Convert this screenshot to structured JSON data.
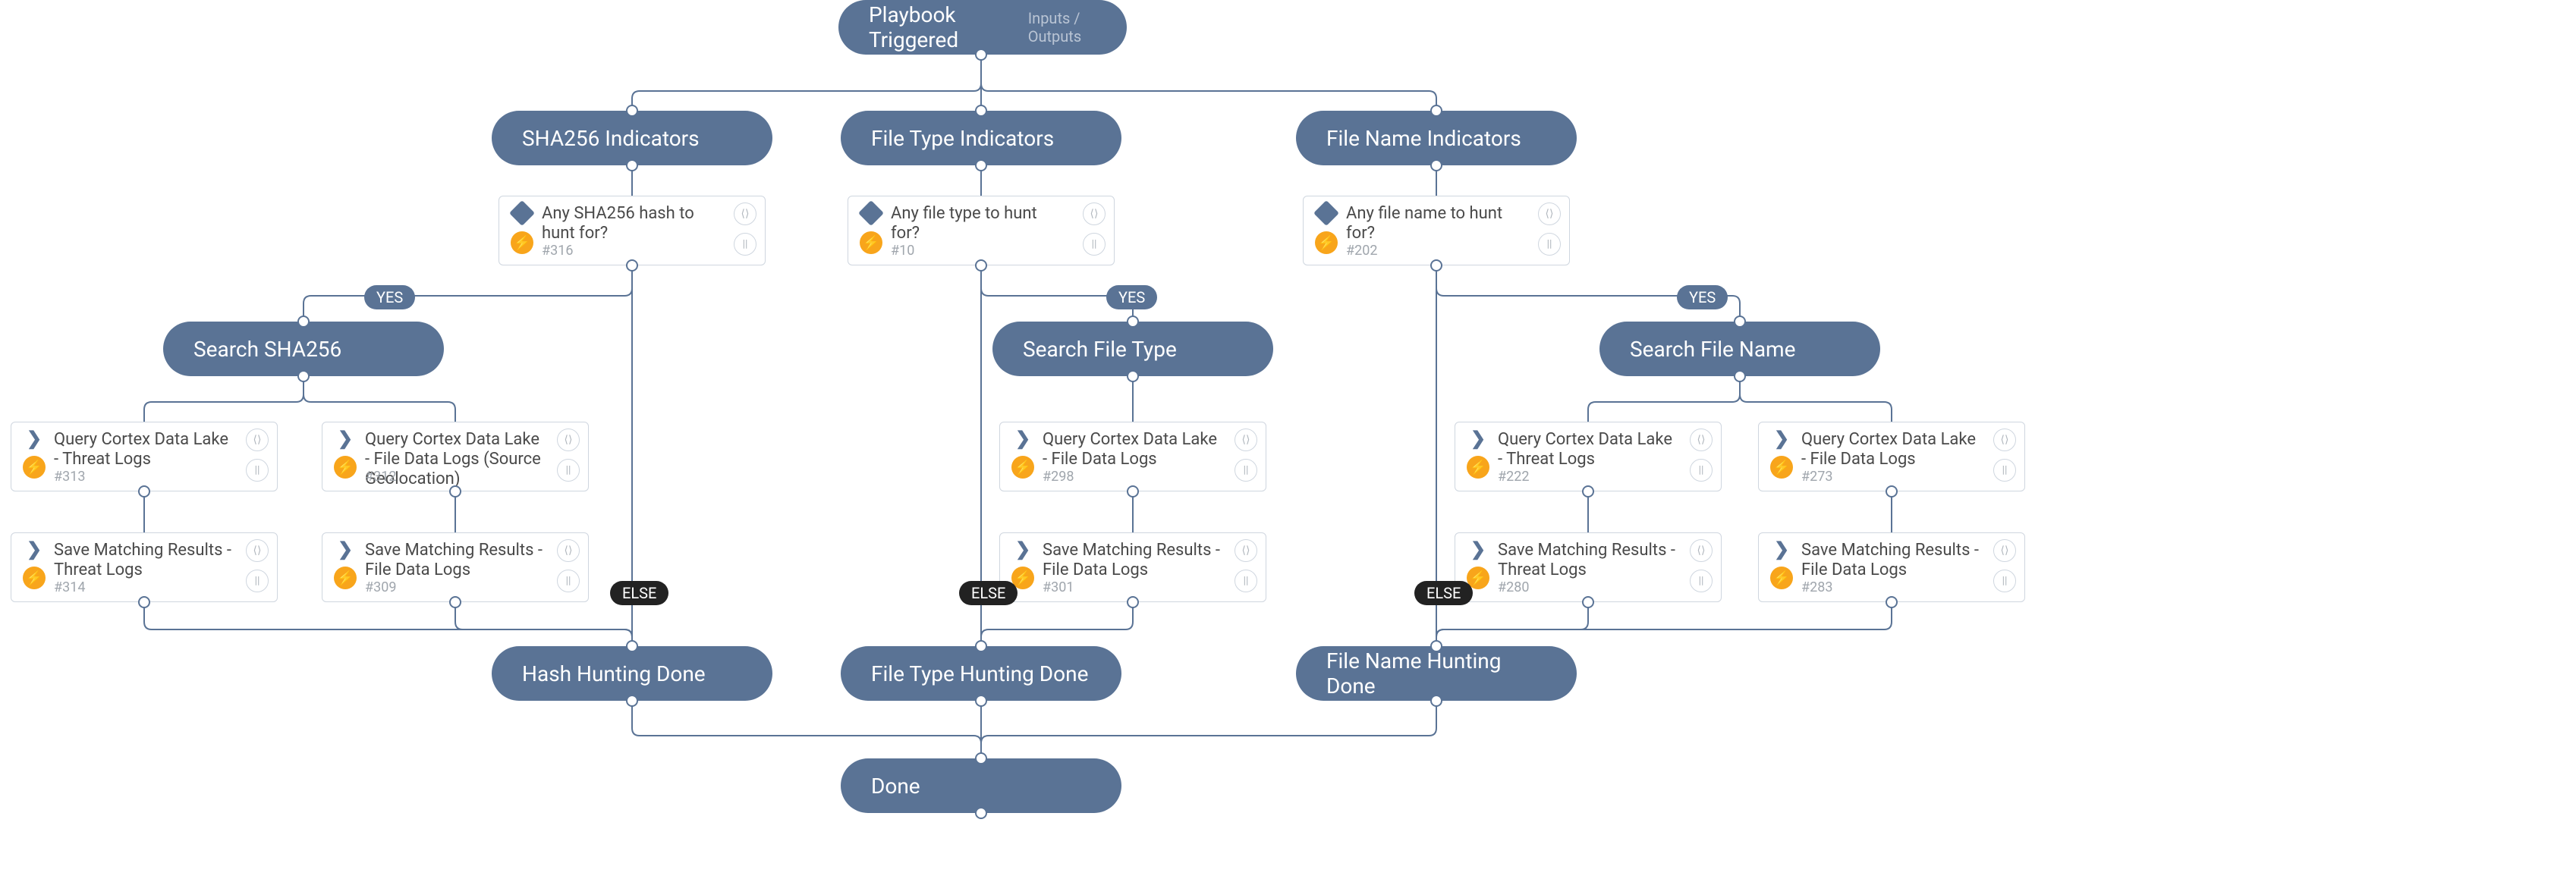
{
  "root": {
    "title": "Playbook Triggered",
    "io_label": "Inputs / Outputs"
  },
  "sections": {
    "sha256": "SHA256 Indicators",
    "filetype": "File Type Indicators",
    "filename": "File Name Indicators",
    "search_sha256": "Search SHA256",
    "search_filetype": "Search File Type",
    "search_filename": "Search File Name",
    "hash_done": "Hash Hunting Done",
    "filetype_done": "File Type Hunting Done",
    "filename_done": "File Name Hunting Done",
    "done": "Done"
  },
  "labels": {
    "yes": "YES",
    "else": "ELSE"
  },
  "tasks": {
    "t316": {
      "title": "Any SHA256 hash to hunt for?",
      "id": "#316"
    },
    "t10": {
      "title": "Any file type to hunt for?",
      "id": "#10"
    },
    "t202": {
      "title": "Any file name to hunt for?",
      "id": "#202"
    },
    "t313": {
      "title": "Query Cortex Data Lake - Threat Logs",
      "id": "#313"
    },
    "t312": {
      "title": "Query Cortex Data Lake - File Data Logs (Source Geolocation)",
      "id": "#312"
    },
    "t298": {
      "title": "Query Cortex Data Lake - File Data Logs",
      "id": "#298"
    },
    "t222": {
      "title": "Query Cortex Data Lake - Threat Logs",
      "id": "#222"
    },
    "t273": {
      "title": "Query Cortex Data Lake - File Data Logs",
      "id": "#273"
    },
    "t314": {
      "title": "Save Matching Results - Threat Logs",
      "id": "#314"
    },
    "t309": {
      "title": "Save Matching Results - File Data Logs",
      "id": "#309"
    },
    "t301": {
      "title": "Save Matching Results - File Data Logs",
      "id": "#301"
    },
    "t280": {
      "title": "Save Matching Results - Threat Logs",
      "id": "#280"
    },
    "t283": {
      "title": "Save Matching Results - File Data Logs",
      "id": "#283"
    }
  },
  "icons": {
    "code": "⟨⟩",
    "pause": "||"
  }
}
